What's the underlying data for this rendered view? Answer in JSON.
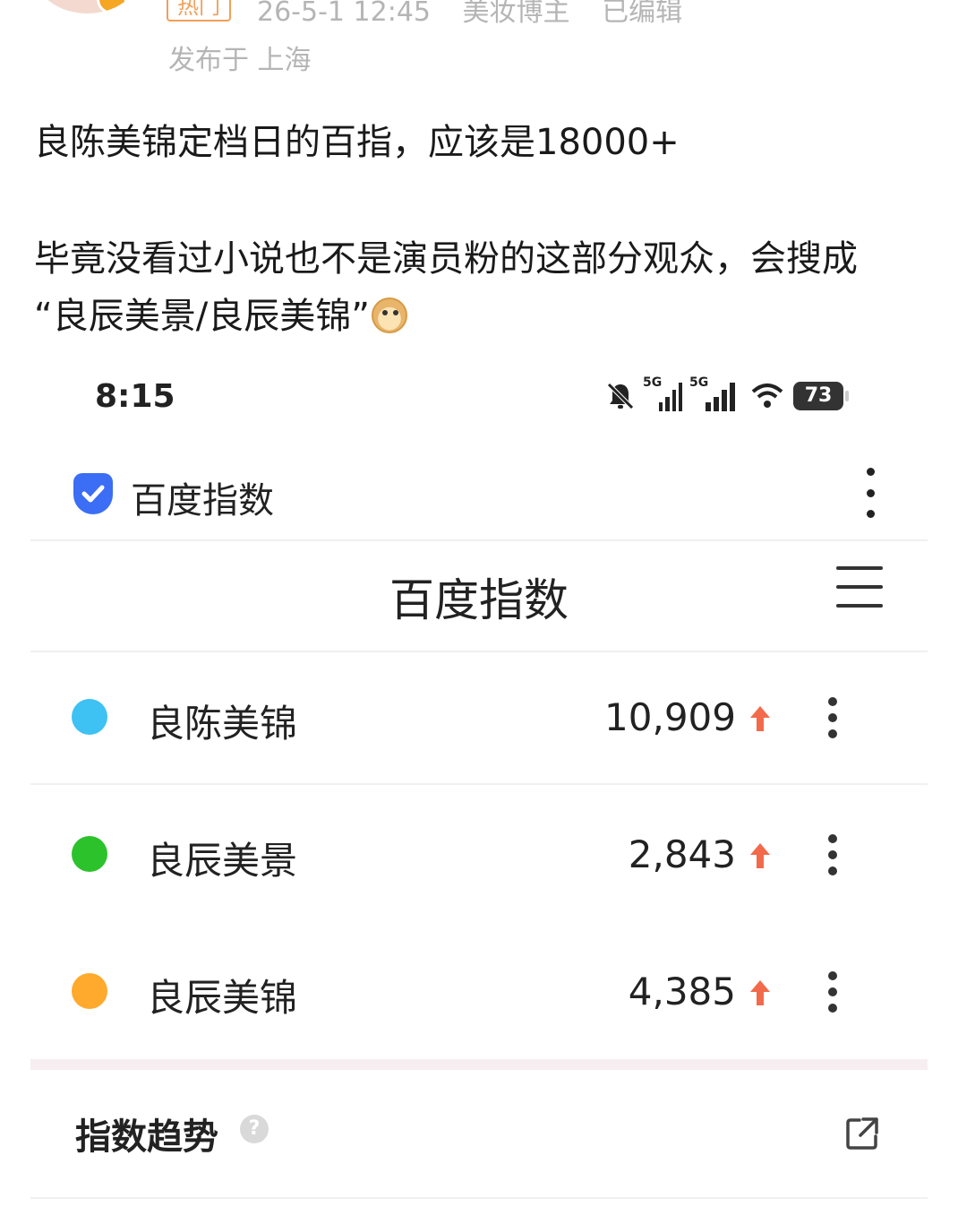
{
  "post": {
    "hot_tag": "热门",
    "date_time": "26-5-1 12:45",
    "author_type": "美妆博主",
    "edited": "已编辑",
    "location": "发布于 上海",
    "line1": "良陈美锦定档日的百指，应该是18000+",
    "line2": "毕竟没看过小说也不是演员粉的这部分观众，会搜成",
    "line3": "“良辰美景/良辰美锦”"
  },
  "screenshot": {
    "status_bar": {
      "time": "8:15",
      "network1": "5G",
      "network2": "5G",
      "battery": "73",
      "icons": [
        "bell-muted-icon",
        "signal-icon",
        "signal-icon",
        "wifi-icon",
        "battery-icon"
      ]
    },
    "app_bar": {
      "title": "百度指数",
      "menu_icon": "more-vertical-icon"
    },
    "page": {
      "title": "百度指数",
      "menu_icon": "hamburger-menu-icon"
    },
    "keywords": [
      {
        "label": "良陈美锦",
        "value": "10,909",
        "color": "#3ec1f3",
        "trend": "up"
      },
      {
        "label": "良辰美景",
        "value": "2,843",
        "color": "#2cc22c",
        "trend": "up"
      },
      {
        "label": "良辰美锦",
        "value": "4,385",
        "color": "#ffaa2c",
        "trend": "up"
      }
    ],
    "trend_section": {
      "title": "指数趋势",
      "help_icon": "question-icon",
      "share_icon": "external-link-icon"
    }
  },
  "colors": {
    "arrow_up": "#f26a4b",
    "brand_blue": "#3b6ef5",
    "meta_gray": "#b5b5b5"
  }
}
